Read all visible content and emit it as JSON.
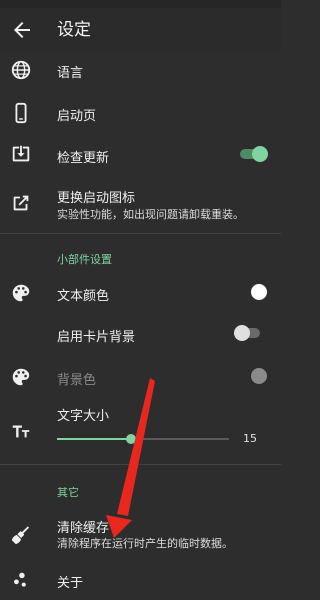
{
  "app_bar": {
    "title": "设定",
    "back_icon": "arrow-left-icon"
  },
  "items": {
    "language": {
      "label": "语言",
      "icon": "globe-icon"
    },
    "start_page": {
      "label": "启动页",
      "icon": "phone-icon"
    },
    "check_update": {
      "label": "检查更新",
      "icon": "download-box-icon",
      "enabled": true
    },
    "change_icon": {
      "label": "更换启动图标",
      "sub": "实验性功能，如出现问题请卸载重装。",
      "icon": "open-external-icon"
    }
  },
  "widget_section": {
    "header": "小部件设置",
    "text_color": {
      "label": "文本颜色",
      "icon": "palette-icon",
      "color": "#ffffff"
    },
    "card_background": {
      "label": "启用卡片背景",
      "enabled": false
    },
    "background_color": {
      "label": "背景色",
      "icon": "palette-icon",
      "color": "#8a8a8a",
      "disabled": true
    },
    "text_size": {
      "label": "文字大小",
      "icon": "text-size-icon",
      "value": "15",
      "fraction": 0.43
    }
  },
  "other_section": {
    "header": "其它",
    "clear_cache": {
      "label": "清除缓存",
      "sub": "清除程序在运行时产生的临时数据。",
      "icon": "broom-icon"
    },
    "about": {
      "label": "关于",
      "icon": "dots-icon"
    }
  },
  "colors": {
    "accent": "#7fd4a0",
    "background": "#2d2d2d",
    "annotation_arrow": "#e8281f"
  }
}
